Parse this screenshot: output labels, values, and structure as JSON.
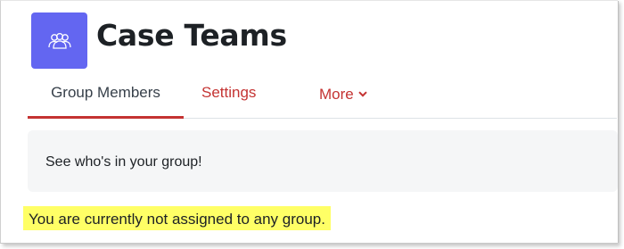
{
  "header": {
    "icon": "group-icon",
    "title": "Case Teams",
    "accent_color": "#6366f1"
  },
  "tabs": [
    {
      "label": "Group Members",
      "active": true
    },
    {
      "label": "Settings",
      "active": false
    },
    {
      "label": "More",
      "active": false,
      "icon": "chevron-down-icon"
    }
  ],
  "info": {
    "text": "See who's in your group!"
  },
  "notice": {
    "text": "You are currently not assigned to any group.",
    "highlight_color": "#ffff66"
  },
  "colors": {
    "link": "#c43332",
    "active_underline": "#c43332",
    "text": "#1d2125"
  }
}
